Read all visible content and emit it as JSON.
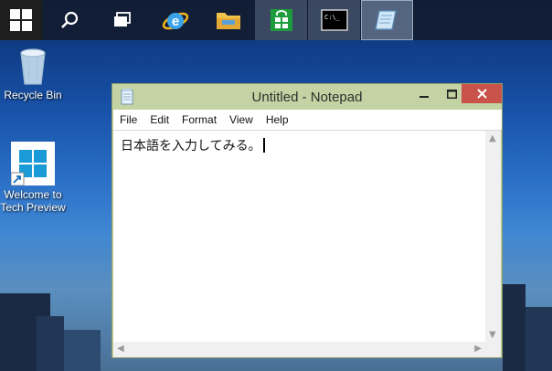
{
  "taskbar": {
    "items": [
      {
        "name": "start-button",
        "icon": "windows-logo-icon"
      },
      {
        "name": "search-button",
        "icon": "search-icon"
      },
      {
        "name": "task-view-button",
        "icon": "task-view-icon"
      },
      {
        "name": "internet-explorer-button",
        "icon": "ie-icon"
      },
      {
        "name": "file-explorer-button",
        "icon": "folder-icon"
      },
      {
        "name": "store-button",
        "icon": "store-icon"
      },
      {
        "name": "command-prompt-button",
        "icon": "cmd-icon"
      },
      {
        "name": "notepad-taskbar-button",
        "icon": "notepad-icon"
      }
    ],
    "cmd_icon_text": "C:\\_"
  },
  "desktop": {
    "recycle_bin_label": "Recycle Bin",
    "welcome_label_line1": "Welcome to",
    "welcome_label_line2": "Tech Preview"
  },
  "window": {
    "title": "Untitled - Notepad",
    "menu": [
      "File",
      "Edit",
      "Format",
      "View",
      "Help"
    ],
    "content": "日本語を入力してみる。"
  },
  "colors": {
    "titlebar": "#c4d3a3",
    "close_button": "#c9524a",
    "taskbar": "#121c30"
  }
}
